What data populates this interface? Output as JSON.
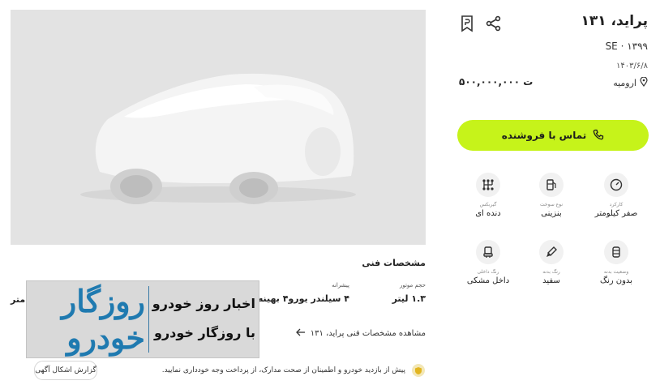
{
  "listing": {
    "title": "پراید، ۱۳۱",
    "trim": "SE · ۱۳۹۹",
    "date": "۱۴۰۳/۶/۸",
    "location": "ارومیه",
    "price": "۵۰۰,۰۰۰,۰۰۰ ت"
  },
  "actions": {
    "contact_label": "تماس با فروشنده"
  },
  "features": [
    {
      "label": "کارکرد",
      "value": "صفر کیلومتر",
      "icon": "speedometer-icon"
    },
    {
      "label": "نوع سوخت",
      "value": "بنزینی",
      "icon": "fuel-icon"
    },
    {
      "label": "گیربکس",
      "value": "دنده ای",
      "icon": "gearbox-icon"
    },
    {
      "label": "وضعیت بدنه",
      "value": "بدون رنگ",
      "icon": "body-condition-icon"
    },
    {
      "label": "رنگ بدنه",
      "value": "سفید",
      "icon": "paint-brush-icon"
    },
    {
      "label": "رنگ داخلی",
      "value": "داخل مشکی",
      "icon": "seat-icon"
    }
  ],
  "specs": {
    "title": "مشخصات فنی",
    "engine_key": "حجم موتور",
    "engine_value": "۱.۳ لیتر",
    "powertrain_key": "پیشرانه",
    "powertrain_value": "۴ سیلندر یورو۴ بهینه ا",
    "clipped_value": "متر",
    "link_label": "مشاهده مشخصات فنی پراید، ۱۳۱"
  },
  "banner": {
    "logo_text": "روزگار خودرو",
    "line1": "اخبار روز خودرو",
    "line2": "با روزگار خودرو"
  },
  "footer": {
    "notice": "پیش از بازدید خودرو و اطمینان از صحت مدارک، از پرداخت وجه خودداری نمایید.",
    "report_label": "گزارش اشکال آگهی"
  },
  "colors": {
    "accent": "#c6f31a",
    "banner_blue": "#1f7ab0",
    "placeholder_bg": "#e3e3e3"
  }
}
